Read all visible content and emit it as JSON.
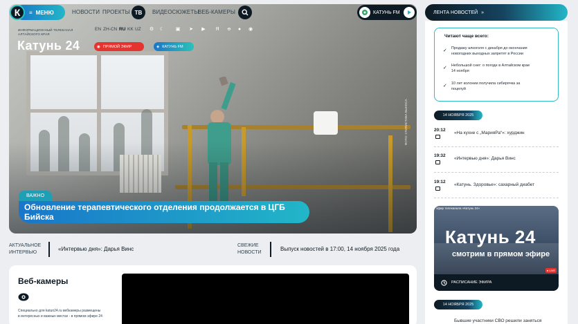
{
  "nav": {
    "logo_letter": "К",
    "menu_label": "МЕНЮ",
    "links": [
      "НОВОСТИ",
      "ПРОЕКТЫ",
      "ВИДЕОСЮЖЕТЫ",
      "ВЕБ-КАМЕРЫ"
    ],
    "tv_label": "ТВ",
    "radio_label": "КАТУНЬ FM"
  },
  "brand": {
    "tagline_line1": "ИНФОРМАЦИОННЫЙ ТЕЛЕКАНАЛ",
    "tagline_line2": "АЛТАЙСКОГО КРАЯ",
    "logo": "Катунь 24",
    "live_button": "ПРЯМОЙ ЭФИР",
    "fm_button": "КАТУНЬ FM"
  },
  "languages": [
    "EN",
    "ZH-CN",
    "RU",
    "KK",
    "UZ"
  ],
  "active_language": "RU",
  "hero": {
    "tag": "ВАЖНО",
    "headline": "Обновление терапевтического отделения продолжается в ЦГБ Бийска",
    "watermark": "ФОТО: СТИЛИСТИКА ВЫНОСА"
  },
  "strip": {
    "left_label_1": "АКТУАЛЬНОЕ",
    "left_label_2": "ИНТЕРВЬЮ",
    "left_text": "«Интервью дня»: Дарья Винс",
    "right_label_1": "СВЕЖИЕ",
    "right_label_2": "НОВОСТИ",
    "right_text": "Выпуск новостей в 17:00, 14 ноября 2025 года"
  },
  "webcams": {
    "title": "Веб-камеры",
    "desc_1": "Специально для katun24.ru вебкамеры размещены",
    "desc_2": "в интересных и важных местах - в прямом эфире 24"
  },
  "sidebar": {
    "feed_header": "ЛЕНТА НОВОСТЕЙ",
    "popular_title": "Читают чаще всего:",
    "popular": [
      {
        "l1": "Продажу алкоголя с декабря до окончания",
        "l2": "новогодних выходных запретят в России"
      },
      {
        "l1": "Небольшой снег: о погоде в Алтайском крае",
        "l2": "14 ноября"
      },
      {
        "l1": "10 лет колонии получила сибирячка за",
        "l2": "поцелуй"
      }
    ],
    "date_1": "14 НОЯБРЯ 2025",
    "feed": [
      {
        "time": "20:12",
        "text": "«На кухне с „МарияРа“»: хурджин"
      },
      {
        "time": "19:32",
        "text": "«Интервью дня»: Дарья Винс"
      },
      {
        "time": "19:12",
        "text": "«Катунь. Здоровье»: сахарный диабет"
      }
    ],
    "promo_small": "эфир телеканала «Катунь 24»",
    "promo_logo": "Катунь 24",
    "promo_sub": "смотрим в прямом эфире",
    "promo_live": "● LIVE",
    "promo_schedule": "РАСПИСАНИЕ ЭФИРА",
    "date_2": "14 НОЯБРЯ 2025",
    "tail_text": "Бывшие участники СВО решили заняться"
  },
  "colors": {
    "accent_blue": "#1976c9",
    "accent_teal": "#22b6c8",
    "dark": "#0e1a23",
    "live_red": "#e5342f"
  }
}
